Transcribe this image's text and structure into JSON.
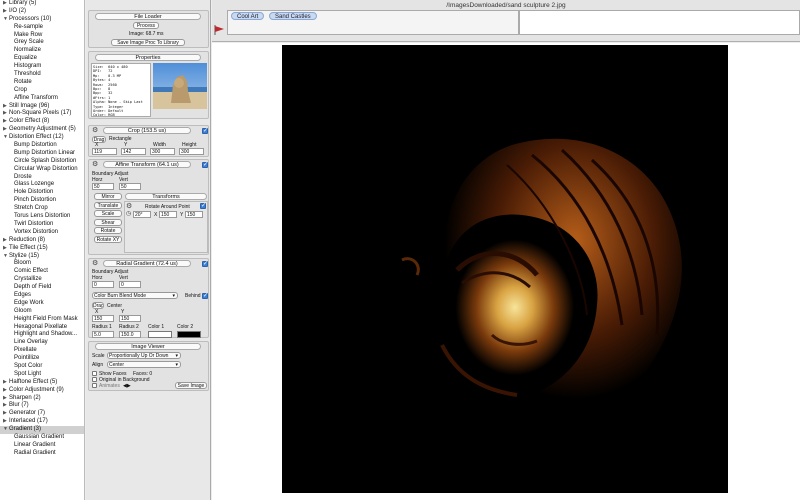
{
  "window": {
    "title": "/ImagesDownloaded/sand sculpture 2.jpg"
  },
  "sidebar": {
    "items": [
      {
        "label": "Library (5)",
        "level": 0,
        "expanded": false
      },
      {
        "label": "I/O (2)",
        "level": 0,
        "expanded": false
      },
      {
        "label": "Processors (10)",
        "level": 0,
        "expanded": true
      },
      {
        "label": "Re-sample",
        "level": 1
      },
      {
        "label": "Make Row",
        "level": 1
      },
      {
        "label": "Grey Scale",
        "level": 1
      },
      {
        "label": "Normalize",
        "level": 1
      },
      {
        "label": "Equalize",
        "level": 1
      },
      {
        "label": "Histogram",
        "level": 1
      },
      {
        "label": "Threshold",
        "level": 1
      },
      {
        "label": "Rotate",
        "level": 1
      },
      {
        "label": "Crop",
        "level": 1
      },
      {
        "label": "Affine Transform",
        "level": 1
      },
      {
        "label": "Still Image (96)",
        "level": 0,
        "expanded": false
      },
      {
        "label": "Non-Square Pixels (17)",
        "level": 0,
        "expanded": false
      },
      {
        "label": "Color Effect (8)",
        "level": 0,
        "expanded": false
      },
      {
        "label": "Geometry Adjustment (5)",
        "level": 0,
        "expanded": false
      },
      {
        "label": "Distortion Effect (12)",
        "level": 0,
        "expanded": true
      },
      {
        "label": "Bump Distortion",
        "level": 1
      },
      {
        "label": "Bump Distortion Linear",
        "level": 1
      },
      {
        "label": "Circle Splash Distortion",
        "level": 1
      },
      {
        "label": "Circular Wrap Distortion",
        "level": 1
      },
      {
        "label": "Droste",
        "level": 1
      },
      {
        "label": "Glass Lozenge",
        "level": 1
      },
      {
        "label": "Hole Distortion",
        "level": 1
      },
      {
        "label": "Pinch Distortion",
        "level": 1
      },
      {
        "label": "Stretch Crop",
        "level": 1
      },
      {
        "label": "Torus Lens Distortion",
        "level": 1
      },
      {
        "label": "Twirl Distortion",
        "level": 1
      },
      {
        "label": "Vortex Distortion",
        "level": 1
      },
      {
        "label": "Reduction (8)",
        "level": 0,
        "expanded": false
      },
      {
        "label": "Tile Effect (15)",
        "level": 0,
        "expanded": false
      },
      {
        "label": "Stylize (15)",
        "level": 0,
        "expanded": true
      },
      {
        "label": "Bloom",
        "level": 1
      },
      {
        "label": "Comic Effect",
        "level": 1
      },
      {
        "label": "Crystallize",
        "level": 1
      },
      {
        "label": "Depth of Field",
        "level": 1
      },
      {
        "label": "Edges",
        "level": 1
      },
      {
        "label": "Edge Work",
        "level": 1
      },
      {
        "label": "Gloom",
        "level": 1
      },
      {
        "label": "Height Field From Mask",
        "level": 1
      },
      {
        "label": "Hexagonal Pixellate",
        "level": 1
      },
      {
        "label": "Highlight and Shadow...",
        "level": 1
      },
      {
        "label": "Line Overlay",
        "level": 1
      },
      {
        "label": "Pixellate",
        "level": 1
      },
      {
        "label": "Pointillize",
        "level": 1
      },
      {
        "label": "Spot Color",
        "level": 1
      },
      {
        "label": "Spot Light",
        "level": 1
      },
      {
        "label": "Halftone Effect (5)",
        "level": 0,
        "expanded": false
      },
      {
        "label": "Color Adjustment (9)",
        "level": 0,
        "expanded": false
      },
      {
        "label": "Sharpen (2)",
        "level": 0,
        "expanded": false
      },
      {
        "label": "Blur (7)",
        "level": 0,
        "expanded": false
      },
      {
        "label": "Generator (7)",
        "level": 0,
        "expanded": false
      },
      {
        "label": "Interlaced (17)",
        "level": 0,
        "expanded": false
      },
      {
        "label": "Gradient (3)",
        "level": 0,
        "expanded": true,
        "selected": true
      },
      {
        "label": "Gaussian Gradient",
        "level": 1
      },
      {
        "label": "Linear Gradient",
        "level": 1
      },
      {
        "label": "Radial Gradient",
        "level": 1
      }
    ]
  },
  "file_loader": {
    "title": "File Loader",
    "process_label": "Process",
    "image_info": "Image: 68.7 ms",
    "save_label": "Save Image Proc To Library"
  },
  "properties": {
    "title": "Properties",
    "lines": [
      "Size:  640 x 480",
      "DPI:   72",
      "Mp:    0.3 MP",
      "Bytes: 4",
      "Rows:  2560",
      "Bpc:   8",
      "Bpp:   32",
      "#Ftrs: 1",
      "Alpha: None - Skip Last",
      "Type:  Integer",
      "Order: Default",
      "Color: RGB"
    ]
  },
  "crop": {
    "title": "Crop   (153.5 us)",
    "drag_label": "Drag",
    "rect_label": "Rectangle",
    "col_labels": [
      "X",
      "Y",
      "Width",
      "Height"
    ],
    "values": [
      "119",
      "142",
      "300",
      "300"
    ]
  },
  "affine": {
    "title": "Affine Transform   (64.1 us)",
    "boundary_label": "Boundary Adjust",
    "horz_label": "Horz",
    "vert_label": "Vert",
    "horz_value": "50",
    "vert_value": "50",
    "buttons": [
      "Mirror",
      "Translate",
      "Scale",
      "Shear",
      "Rotate",
      "Rotate XY"
    ],
    "transforms_label": "Transforms",
    "rotate_label": "Rotate Around Point",
    "angle_value": "20°",
    "x_label": "X",
    "x_value": "150",
    "y_label": "Y",
    "y_value": "150"
  },
  "radial": {
    "title": "Radial Gradient   (72.4 us)",
    "boundary_label": "Boundary Adjust",
    "horz_label": "Horz",
    "vert_label": "Vert",
    "horz_value": "0",
    "vert_value": "0",
    "blend_mode": "Color Burn Blend Mode",
    "behind_label": "Behind",
    "drag_label": "Drag",
    "center_label": "Center",
    "x_label": "X",
    "y_label": "Y",
    "x_value": "150",
    "y_value": "150",
    "radius1_label": "Radius 1",
    "radius2_label": "Radius 2",
    "color1_label": "Color 1",
    "color2_label": "Color 2",
    "radius1_value": "5.0",
    "radius2_value": "150.0",
    "color1": "#ffffff",
    "color2": "#000000"
  },
  "image_viewer": {
    "title": "Image Viewer",
    "scale_label": "Scale",
    "scale_value": "Proportionally Up Or Down",
    "align_label": "Align",
    "align_value": "Center",
    "show_faces_label": "Show Faces",
    "faces_count": "Faces: 0",
    "original_bg_label": "Original in Background",
    "animates_label": "Animates",
    "save_label": "Save Image"
  },
  "toolbar": {
    "tags": [
      "Cool Art",
      "Sand Castles"
    ]
  },
  "colors": {
    "accent": "#3c7fd6",
    "flag": "#c0282d",
    "tag_bg": "#c9d9ef"
  }
}
